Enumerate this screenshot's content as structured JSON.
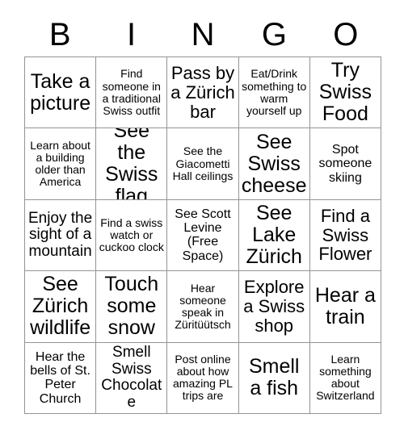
{
  "card": {
    "title_letters": [
      "B",
      "I",
      "N",
      "G",
      "O"
    ],
    "grid": {
      "columns": 5,
      "rows": 5,
      "cells": [
        {
          "text": "Take a picture",
          "size": "xxl"
        },
        {
          "text": "Find someone in a traditional Swiss outfit",
          "size": "s"
        },
        {
          "text": "Pass by a Zürich bar",
          "size": "xl"
        },
        {
          "text": "Eat/Drink something to warm yourself up",
          "size": "s"
        },
        {
          "text": "Try Swiss Food",
          "size": "xxl"
        },
        {
          "text": "Learn about a building older than America",
          "size": "s"
        },
        {
          "text": "See the Swiss flag",
          "size": "xxl"
        },
        {
          "text": "See the Giacometti Hall ceilings",
          "size": "s"
        },
        {
          "text": "See Swiss cheese",
          "size": "xxl"
        },
        {
          "text": "Spot someone skiing",
          "size": "m"
        },
        {
          "text": "Enjoy the sight of a mountain",
          "size": "l"
        },
        {
          "text": "Find a swiss watch or cuckoo clock",
          "size": "s"
        },
        {
          "text": "See Scott Levine (Free Space)",
          "size": "m"
        },
        {
          "text": "See Lake Zürich",
          "size": "xxl"
        },
        {
          "text": "Find a Swiss Flower",
          "size": "xl"
        },
        {
          "text": "See Zürich wildlife",
          "size": "xxl"
        },
        {
          "text": "Touch some snow",
          "size": "xxl"
        },
        {
          "text": "Hear someone speak in Züritüütsch",
          "size": "s"
        },
        {
          "text": "Explore a Swiss shop",
          "size": "xl"
        },
        {
          "text": "Hear a train",
          "size": "xxl"
        },
        {
          "text": "Hear the bells of St. Peter Church",
          "size": "m"
        },
        {
          "text": "Smell Swiss Chocolate",
          "size": "l"
        },
        {
          "text": "Post online about how amazing PL trips are",
          "size": "s"
        },
        {
          "text": "Smell a fish",
          "size": "xxl"
        },
        {
          "text": "Learn something about Switzerland",
          "size": "s"
        }
      ]
    }
  },
  "colors": {
    "background": "#ffffff",
    "text": "#000000",
    "grid_line": "#949494"
  }
}
